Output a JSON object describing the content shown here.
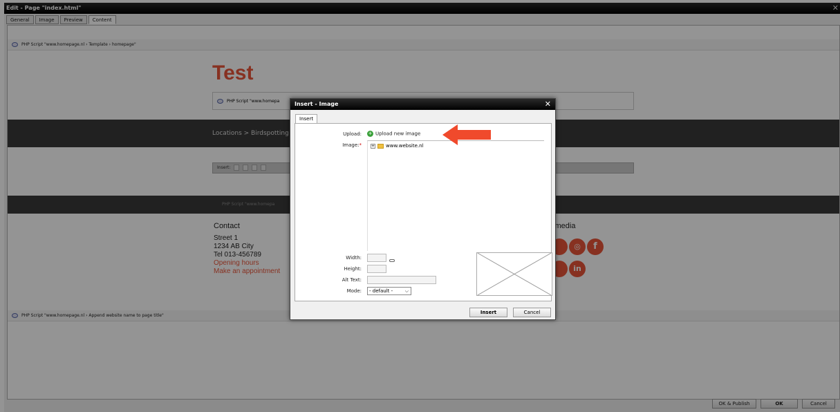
{
  "window": {
    "title": "Edit - Page \"index.html\"",
    "close": "✕"
  },
  "tabs": [
    "General",
    "Image",
    "Preview",
    "Content"
  ],
  "content": {
    "php_top": "PHP Script \"www.homepage.nl › Template › homepage\"",
    "site_title": "Test",
    "php_inner": "PHP Script \"www.homepa",
    "breadcrumb": "Locations > Birdspotting",
    "insert_label": "Insert:",
    "php_band": "PHP Script \"www.homepa",
    "contact": {
      "heading": "Contact",
      "street": "Street 1",
      "city": "1234 AB City",
      "tel": "Tel 013-456789",
      "opening": "Opening hours",
      "appointment": "Make an appointment"
    },
    "social_heading": "l media",
    "php_bottom": "PHP Script \"www.homepage.nl › Append website name to page title\""
  },
  "buttons": {
    "ok_publish": "OK & Publish",
    "ok": "OK",
    "cancel": "Cancel"
  },
  "dialog": {
    "title": "Insert - Image",
    "close": "✕",
    "tab": "Insert",
    "upload_label": "Upload:",
    "upload_link": "Upload new image",
    "image_label": "Image:",
    "required_mark": "*",
    "tree_root": "www.website.nl",
    "tree_expand": "+",
    "width_label": "Width:",
    "height_label": "Height:",
    "alt_label": "Alt Text:",
    "mode_label": "Mode:",
    "mode_value": "- default -",
    "insert_button": "Insert",
    "cancel_button": "Cancel"
  },
  "colors": {
    "accent": "#e8553a",
    "arrow": "#f04a2c",
    "band": "#3a3a3a"
  }
}
